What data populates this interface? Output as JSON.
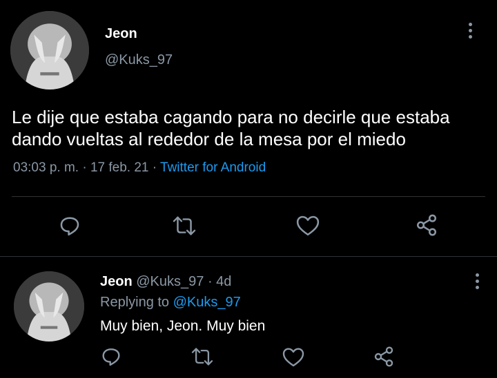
{
  "tweet": {
    "author_name": "Jeon",
    "author_handle": "@Kuks_97",
    "text_line1": "Le dije que estaba cagando para no decirle que estaba",
    "text_line2": "dando vueltas al rededor de la mesa por el miedo",
    "time": "03:03 p. m.",
    "sep1": "·",
    "date": "17 feb. 21",
    "sep2": "·",
    "source": "Twitter for Android"
  },
  "actions": [
    "reply-icon",
    "retweet-icon",
    "like-icon",
    "share-icon"
  ],
  "reply": {
    "author_name": "Jeon",
    "author_handle": "@Kuks_97",
    "age": "· 4d",
    "replying_prefix": "Replying to",
    "replying_handle": "@Kuks_97",
    "text": "Muy bien, Jeon. Muy bien"
  },
  "colors": {
    "background": "#000000",
    "muted": "#8b98a5",
    "link": "#1d9bf0",
    "divider": "#2f3336"
  }
}
